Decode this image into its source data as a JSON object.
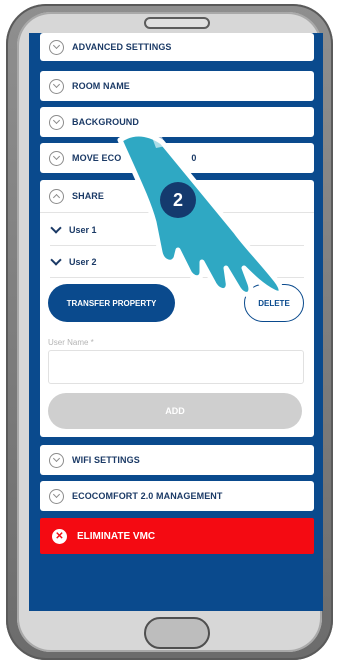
{
  "settings_menu": [
    {
      "label": "ADVANCED SETTINGS",
      "icon": "chevron-circle-icon"
    },
    {
      "label": "ROOM NAME",
      "icon": "chevron-circle-icon"
    },
    {
      "label": "BACKGROUND",
      "icon": "chevron-circle-icon"
    },
    {
      "label": "MOVE ECO",
      "label_tail": "0",
      "icon": "chevron-circle-icon"
    }
  ],
  "share": {
    "title": "SHARE",
    "icon": "chevron-up-circle-icon",
    "users": [
      "User 1",
      "User 2"
    ],
    "transfer_label": "TRANSFER PROPERTY",
    "delete_label": "DELETE",
    "user_name_placeholder": "User Name *",
    "add_label": "ADD"
  },
  "bottom_menu": [
    {
      "label": "WIFI SETTINGS"
    },
    {
      "label": "ECOCOMFORT 2.0 MANAGEMENT"
    }
  ],
  "eliminate": {
    "label": "ELIMINATE VMC",
    "icon": "close-circle-icon"
  },
  "step_badge": "2",
  "colors": {
    "primary_blue": "#0a4a8d",
    "eliminate_red": "#f40a12",
    "hand_teal": "#2fa8c3",
    "badge_navy": "#143a6e"
  }
}
